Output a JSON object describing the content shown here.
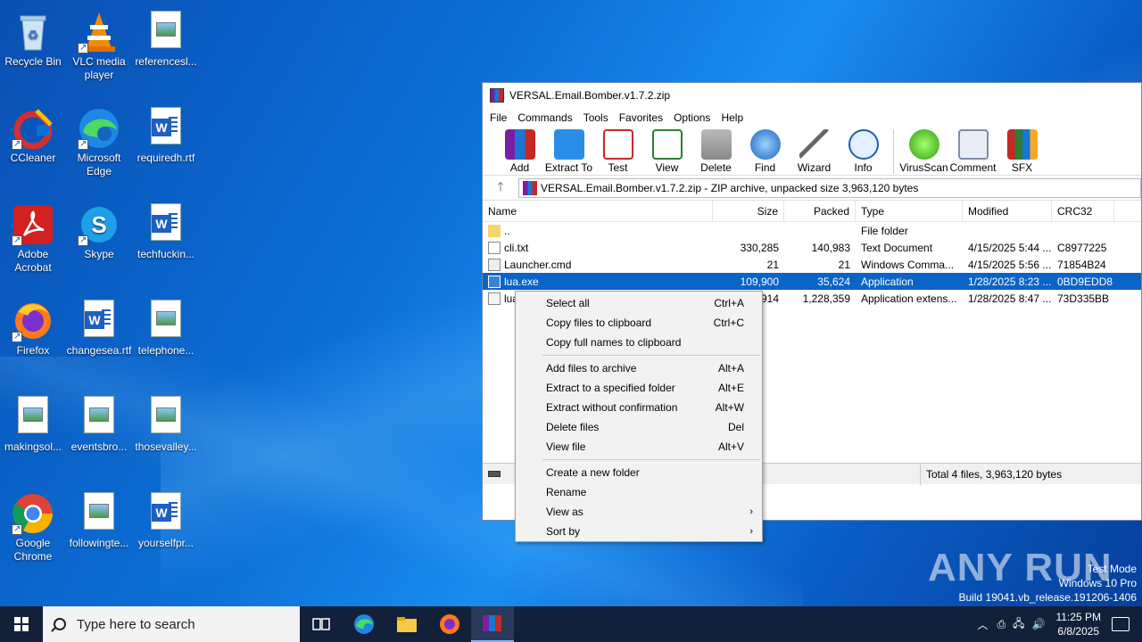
{
  "desktop": {
    "icons": [
      {
        "label": "Recycle Bin"
      },
      {
        "label": "VLC media player"
      },
      {
        "label": "referencesl..."
      },
      {
        "label": "CCleaner"
      },
      {
        "label": "Microsoft Edge"
      },
      {
        "label": "requiredh.rtf"
      },
      {
        "label": "Adobe Acrobat"
      },
      {
        "label": "Skype"
      },
      {
        "label": "techfuckin..."
      },
      {
        "label": "Firefox"
      },
      {
        "label": "changesea.rtf"
      },
      {
        "label": "telephone..."
      },
      {
        "label": "makingsol..."
      },
      {
        "label": "eventsbro..."
      },
      {
        "label": "thosevalley..."
      },
      {
        "label": "Google Chrome"
      },
      {
        "label": "followingte..."
      },
      {
        "label": "yourselfpr..."
      }
    ]
  },
  "winrar": {
    "title": "VERSAL.Email.Bomber.v1.7.2.zip",
    "menu": [
      "File",
      "Commands",
      "Tools",
      "Favorites",
      "Options",
      "Help"
    ],
    "toolbar": [
      "Add",
      "Extract To",
      "Test",
      "View",
      "Delete",
      "Find",
      "Wizard",
      "Info",
      "VirusScan",
      "Comment",
      "SFX"
    ],
    "address": "VERSAL.Email.Bomber.v1.7.2.zip - ZIP archive, unpacked size 3,963,120 bytes",
    "columns": [
      "Name",
      "Size",
      "Packed",
      "Type",
      "Modified",
      "CRC32"
    ],
    "files": [
      {
        "name": "..",
        "size": "",
        "packed": "",
        "type": "File folder",
        "modified": "",
        "crc": ""
      },
      {
        "name": "cli.txt",
        "size": "330,285",
        "packed": "140,983",
        "type": "Text Document",
        "modified": "4/15/2025 5:44 ...",
        "crc": "C8977225"
      },
      {
        "name": "Launcher.cmd",
        "size": "21",
        "packed": "21",
        "type": "Windows Comma...",
        "modified": "4/15/2025 5:56 ...",
        "crc": "71854B24"
      },
      {
        "name": "lua.exe",
        "size": "109,900",
        "packed": "35,624",
        "type": "Application",
        "modified": "1/28/2025 8:23 ...",
        "crc": "0BD9EDD8"
      },
      {
        "name": "lua54.dll",
        "size": "3,522,914",
        "packed": "1,228,359",
        "type": "Application extens...",
        "modified": "1/28/2025 8:47 ...",
        "crc": "73D335BB"
      }
    ],
    "status": "Total 4 files, 3,963,120 bytes"
  },
  "context_menu": {
    "items": [
      {
        "label": "Select all",
        "shortcut": "Ctrl+A"
      },
      {
        "label": "Copy files to clipboard",
        "shortcut": "Ctrl+C"
      },
      {
        "label": "Copy full names to clipboard",
        "shortcut": ""
      },
      {
        "label": "Add files to archive",
        "shortcut": "Alt+A"
      },
      {
        "label": "Extract to a specified folder",
        "shortcut": "Alt+E"
      },
      {
        "label": "Extract without confirmation",
        "shortcut": "Alt+W"
      },
      {
        "label": "Delete files",
        "shortcut": "Del"
      },
      {
        "label": "View file",
        "shortcut": "Alt+V"
      },
      {
        "label": "Create a new folder",
        "shortcut": ""
      },
      {
        "label": "Rename",
        "shortcut": ""
      },
      {
        "label": "View as",
        "shortcut": "›"
      },
      {
        "label": "Sort by",
        "shortcut": "›"
      }
    ]
  },
  "taskbar": {
    "search_placeholder": "Type here to search",
    "time": "11:25 PM",
    "date": "6/8/2025"
  },
  "watermark": {
    "brand": "ANY RUN",
    "line1": "Test Mode",
    "line2": "Windows 10 Pro",
    "line3": "Build 19041.vb_release.191206-1406"
  },
  "colors": {
    "selection": "#0a64c8",
    "taskbar": "#12203a"
  }
}
